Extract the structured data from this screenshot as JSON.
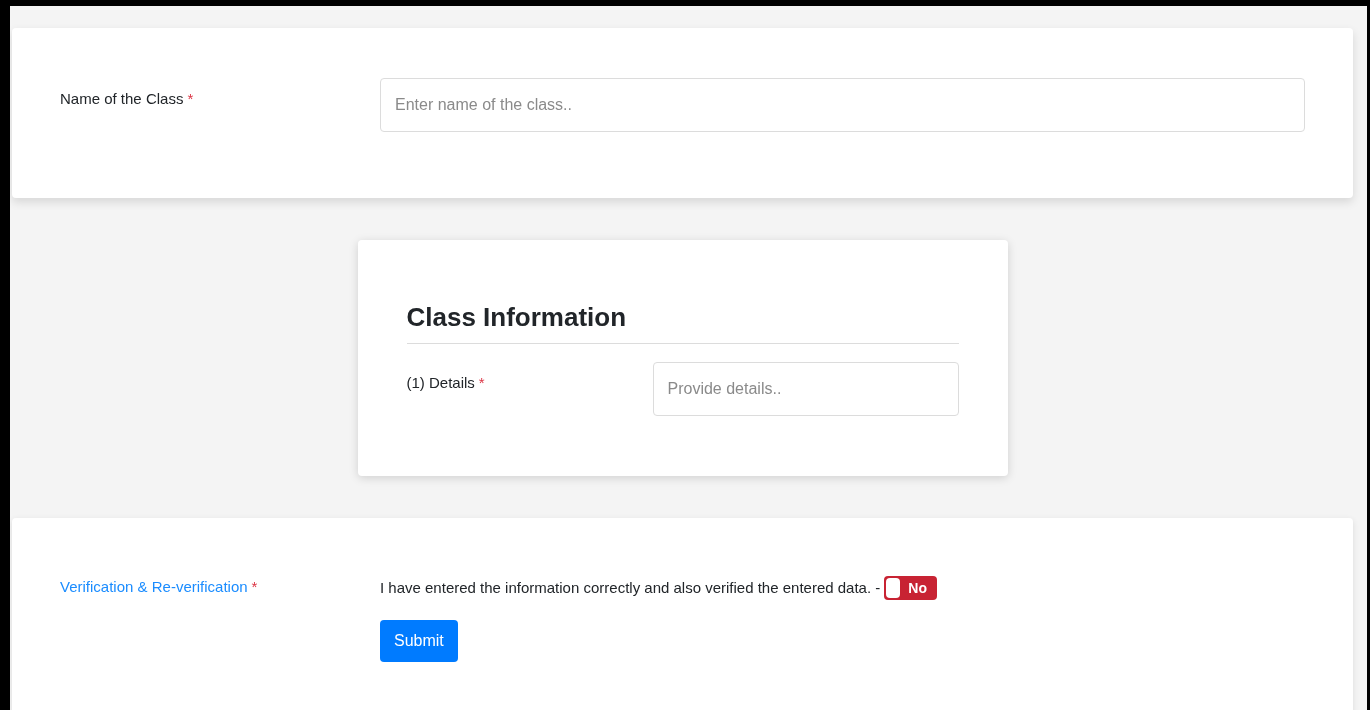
{
  "name_field": {
    "label": "Name of the Class",
    "required_mark": "*",
    "placeholder": "Enter name of the class.."
  },
  "class_information": {
    "title": "Class Information",
    "fields": [
      {
        "label": "(1) Details",
        "required_mark": "*",
        "placeholder": "Provide details.."
      }
    ]
  },
  "verification": {
    "label": "Verification & Re-verification",
    "required_mark": "*",
    "statement": "I have entered the information correctly and also verified the entered data. -",
    "toggle": {
      "on": false,
      "label": "No"
    },
    "submit": "Submit"
  }
}
